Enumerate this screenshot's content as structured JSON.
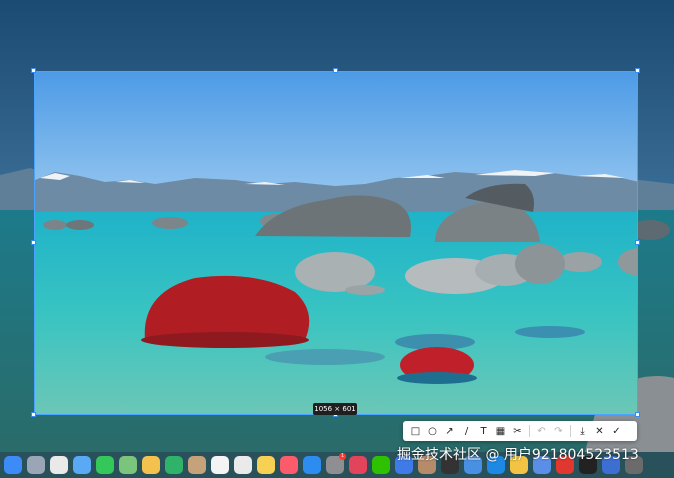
{
  "selection": {
    "size_label": "1056 × 601"
  },
  "toolbar": {
    "tools": [
      {
        "name": "rectangle-tool",
        "glyph": "□"
      },
      {
        "name": "ellipse-tool",
        "glyph": "○"
      },
      {
        "name": "arrow-tool",
        "glyph": "↗"
      },
      {
        "name": "pen-tool",
        "glyph": "/"
      },
      {
        "name": "text-tool",
        "glyph": "T"
      },
      {
        "name": "mosaic-tool",
        "glyph": "▦"
      },
      {
        "name": "magic-tool",
        "glyph": "✂"
      }
    ],
    "actions": [
      {
        "name": "undo-button",
        "glyph": "↶",
        "enabled": false
      },
      {
        "name": "redo-button",
        "glyph": "↷",
        "enabled": false
      },
      {
        "name": "download-button",
        "glyph": "⤓",
        "enabled": true
      },
      {
        "name": "close-button",
        "glyph": "✕",
        "enabled": true
      },
      {
        "name": "confirm-button",
        "glyph": "✓",
        "enabled": true
      }
    ]
  },
  "dock": {
    "apps": [
      {
        "name": "finder",
        "color": "#3d8bf7"
      },
      {
        "name": "launchpad",
        "color": "#9aa6b5"
      },
      {
        "name": "chrome",
        "color": "#e9e9e9"
      },
      {
        "name": "safari",
        "color": "#5aa9f5"
      },
      {
        "name": "messages",
        "color": "#34c759"
      },
      {
        "name": "maps",
        "color": "#7ac47c"
      },
      {
        "name": "photos",
        "color": "#f2c14e"
      },
      {
        "name": "facetime",
        "color": "#2fb36b"
      },
      {
        "name": "contacts",
        "color": "#c6a27b"
      },
      {
        "name": "calendar",
        "color": "#f4f4f4"
      },
      {
        "name": "reminders",
        "color": "#eaeaea"
      },
      {
        "name": "notes",
        "color": "#f7d154"
      },
      {
        "name": "music",
        "color": "#fb5b6b"
      },
      {
        "name": "app-store",
        "color": "#2d8cf0"
      },
      {
        "name": "system-settings",
        "color": "#8e8e93",
        "badge": "1"
      },
      {
        "name": "app-red",
        "color": "#e2455b"
      },
      {
        "name": "wechat",
        "color": "#2dc100"
      },
      {
        "name": "app-blue",
        "color": "#3f7be8"
      },
      {
        "name": "app-avatar",
        "color": "#b58b6a"
      },
      {
        "name": "app-panda",
        "color": "#333333"
      },
      {
        "name": "app-folder",
        "color": "#4a90e2"
      },
      {
        "name": "app-qq",
        "color": "#1e88e5"
      },
      {
        "name": "app-yellow",
        "color": "#f3c443"
      },
      {
        "name": "app-window",
        "color": "#5b8ee6"
      },
      {
        "name": "wps",
        "color": "#e0372f"
      },
      {
        "name": "app-dark",
        "color": "#222222"
      },
      {
        "name": "app-screen",
        "color": "#3c6fd1"
      },
      {
        "name": "app-last",
        "color": "#6b6b6b"
      }
    ]
  },
  "watermark": "掘金技术社区 @ 用户921804523513"
}
